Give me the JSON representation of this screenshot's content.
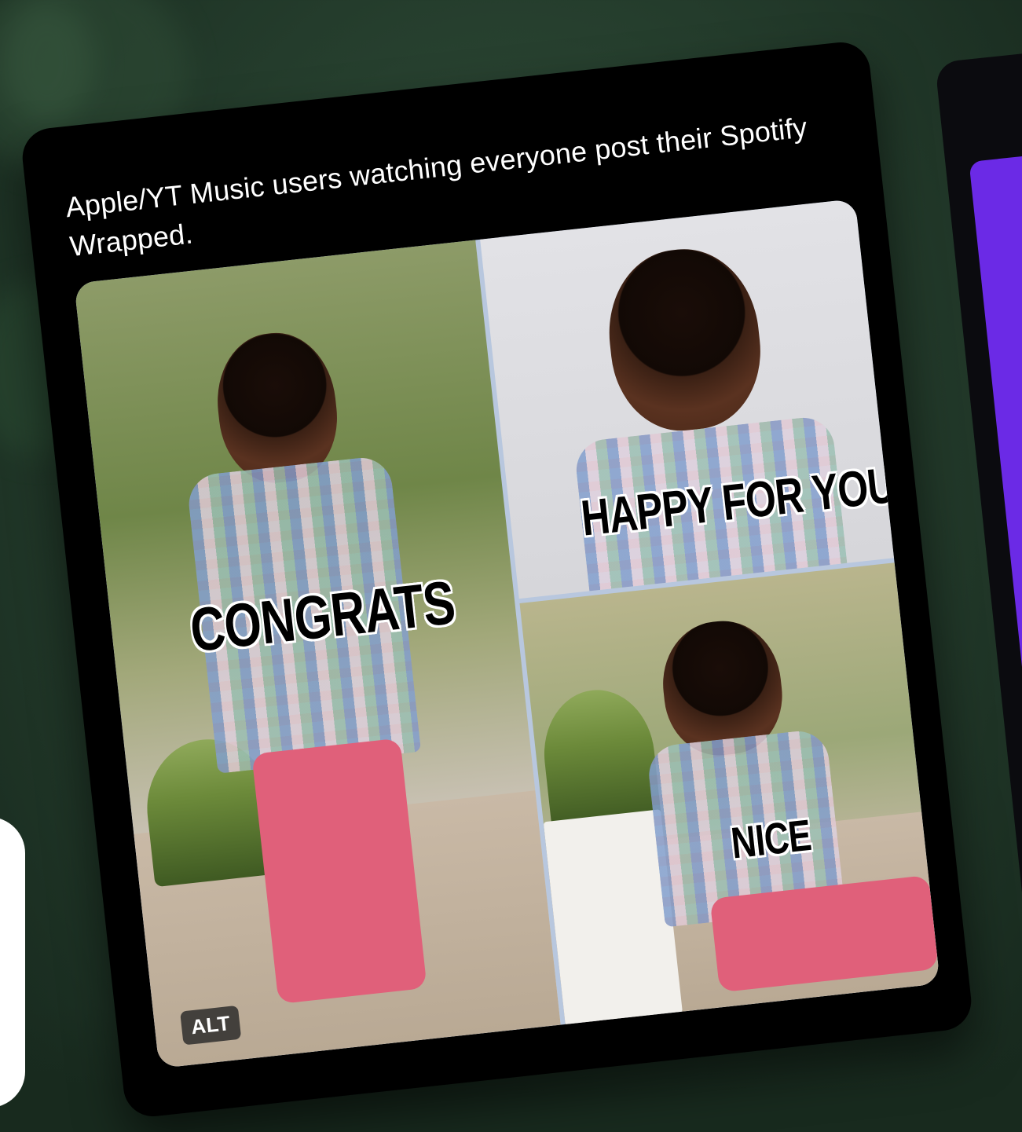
{
  "post": {
    "text": "Apple/YT Music users watching everyone post their Spotify Wrapped."
  },
  "media": {
    "captions": {
      "left": "CONGRATS",
      "top_right": "HAPPY FOR YOU",
      "bottom_right": "NICE"
    },
    "alt_badge": "ALT"
  },
  "colors": {
    "background": "#263f2e",
    "card": "#000000",
    "side_card_purple": "#6b2ae6"
  }
}
